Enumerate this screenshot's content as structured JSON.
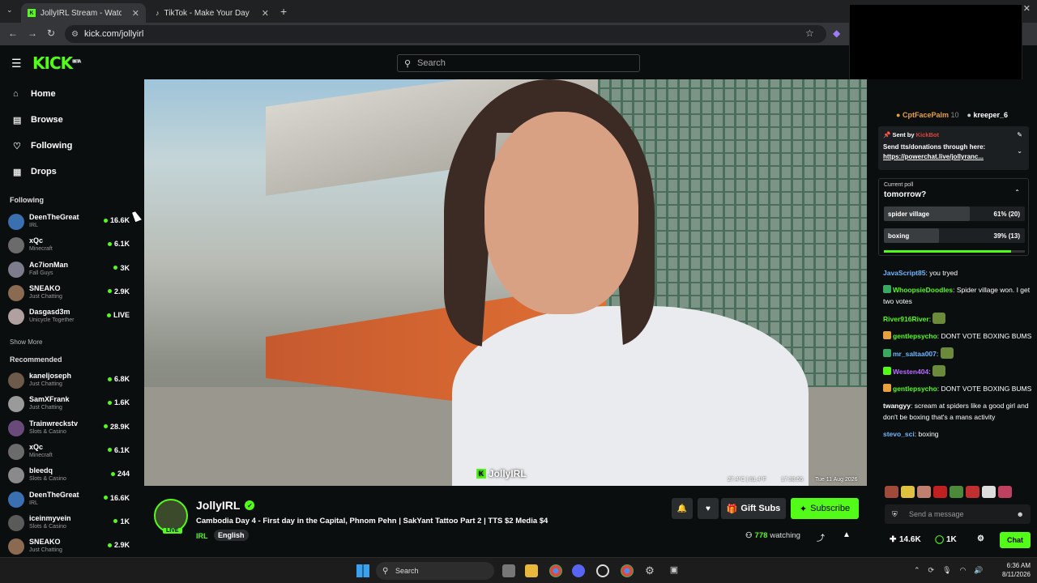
{
  "browser": {
    "tabs": [
      {
        "label": "JollyIRL Stream - Watch Live",
        "favicon": "kick-icon"
      },
      {
        "label": "TikTok - Make Your Day",
        "favicon": "tiktok-icon"
      }
    ],
    "new_tab": "+",
    "url": "kick.com/jollyirl"
  },
  "header": {
    "logo": "KICK",
    "logo_badge": "BETA",
    "search_placeholder": "Search"
  },
  "sidebar": {
    "nav": [
      {
        "label": "Home",
        "icon": "home-icon",
        "glyph": "⌂"
      },
      {
        "label": "Browse",
        "icon": "browse-icon",
        "glyph": "▤"
      },
      {
        "label": "Following",
        "icon": "heart-icon",
        "glyph": "♡"
      },
      {
        "label": "Drops",
        "icon": "drops-icon",
        "glyph": "▦"
      }
    ],
    "following_heading": "Following",
    "following": [
      {
        "name": "DeenTheGreat",
        "category": "IRL",
        "viewers": "16.6K",
        "avatar_color": "#3a6fb0"
      },
      {
        "name": "xQc",
        "category": "Minecraft",
        "viewers": "6.1K",
        "avatar_color": "#6b6b6b"
      },
      {
        "name": "Ac7ionMan",
        "category": "Fall Guys",
        "viewers": "3K",
        "avatar_color": "#7c7c8c"
      },
      {
        "name": "SNEAKO",
        "category": "Just Chatting",
        "viewers": "2.9K",
        "avatar_color": "#8a6a50"
      },
      {
        "name": "Dasgasd3m",
        "category": "Unicycle Together",
        "viewers": "LIVE",
        "avatar_color": "#b0a0a0"
      }
    ],
    "show_more": "Show More",
    "recommended_heading": "Recommended",
    "recommended": [
      {
        "name": "kaneljoseph",
        "category": "Just Chatting",
        "viewers": "6.8K",
        "avatar_color": "#6e5a4a"
      },
      {
        "name": "SamXFrank",
        "category": "Just Chatting",
        "viewers": "1.6K",
        "avatar_color": "#9a9a9a"
      },
      {
        "name": "Trainwreckstv",
        "category": "Slots & Casino",
        "viewers": "28.9K",
        "avatar_color": "#6a4a7a"
      },
      {
        "name": "xQc",
        "category": "Minecraft",
        "viewers": "6.1K",
        "avatar_color": "#6b6b6b"
      },
      {
        "name": "bleedq",
        "category": "Slots & Casino",
        "viewers": "244",
        "avatar_color": "#8a8a8a"
      },
      {
        "name": "DeenTheGreat",
        "category": "IRL",
        "viewers": "16.6K",
        "avatar_color": "#3a6fb0"
      },
      {
        "name": "iceinmyvein",
        "category": "Slots & Casino",
        "viewers": "1K",
        "avatar_color": "#5a5a5a"
      },
      {
        "name": "SNEAKO",
        "category": "Just Chatting",
        "viewers": "2.9K",
        "avatar_color": "#8a6a50"
      }
    ]
  },
  "video": {
    "watermark": "JollyIRL",
    "osd_temp": "27.4°C | 81.4°F",
    "osd_time": "17:38:56",
    "osd_date": "Tue 11 Aug 2026"
  },
  "stream": {
    "live_badge": "LIVE",
    "channel": "JollyIRL",
    "title": "Cambodia Day 4 - First day in the Capital, Phnom Pehn | SakYant Tattoo Part 2 | TTS $2 Media $4",
    "category": "IRL",
    "tag": "English",
    "gift_label": "Gift Subs",
    "subscribe_label": "Subscribe",
    "watching_count": "778",
    "watching_label": "watching"
  },
  "chat": {
    "top_users": [
      {
        "name": "CptFacePalm",
        "count": "10"
      },
      {
        "name": "kreeper_6",
        "count": ""
      }
    ],
    "pinned": {
      "sent_by_label": "Sent by",
      "sender": "KickBot",
      "text": "Send tts/donations through here:",
      "link": "https://powerchat.live/jollyranc..."
    },
    "poll": {
      "heading": "Current poll",
      "question": "tomorrow?",
      "options": [
        {
          "label": "spider village",
          "result": "61% (20)",
          "fraction": 0.61
        },
        {
          "label": "boxing",
          "result": "39% (13)",
          "fraction": 0.39
        }
      ],
      "progress": 0.9
    },
    "messages": [
      {
        "user": "JavaScript85",
        "color": "#6fb6ff",
        "text": "you tryed",
        "badge": ""
      },
      {
        "user": "WhoopsieDoodles",
        "color": "#53fc18",
        "text": "Spider village won. I get two votes",
        "badge": "#3aa860"
      },
      {
        "user": "River916River",
        "color": "#53fc18",
        "text": "",
        "badge": "",
        "emote": true
      },
      {
        "user": "gentlepsycho",
        "color": "#53fc18",
        "text": "DONT VOTE BOXING BUMS",
        "badge": "#e8a040"
      },
      {
        "user": "mr_saltaa007",
        "color": "#6fb6ff",
        "text": "",
        "badge": "#3aa860",
        "emote": true
      },
      {
        "user": "Westen404",
        "color": "#b86cff",
        "text": "",
        "badge": "#53fc18",
        "emote": true
      },
      {
        "user": "gentlepsycho",
        "color": "#53fc18",
        "text": "DONT VOTE BOXING BUMS",
        "badge": "#e8a040"
      },
      {
        "user": "twangyy",
        "color": "#ffffff",
        "text": "scream at spiders like a good girl and don't be boxing that's a mans activity",
        "badge": ""
      },
      {
        "user": "stevo_sci",
        "color": "#6fb6ff",
        "text": "boxing",
        "badge": ""
      }
    ],
    "input_placeholder": "Send a message",
    "footer": {
      "count_a": "14.6K",
      "count_b": "1K",
      "chat_label": "Chat"
    }
  },
  "taskbar": {
    "search_placeholder": "Search",
    "time": "6:36 AM",
    "date": "8/11/2026"
  },
  "colors": {
    "accent": "#53fc18",
    "background": "#0b0e0f"
  }
}
